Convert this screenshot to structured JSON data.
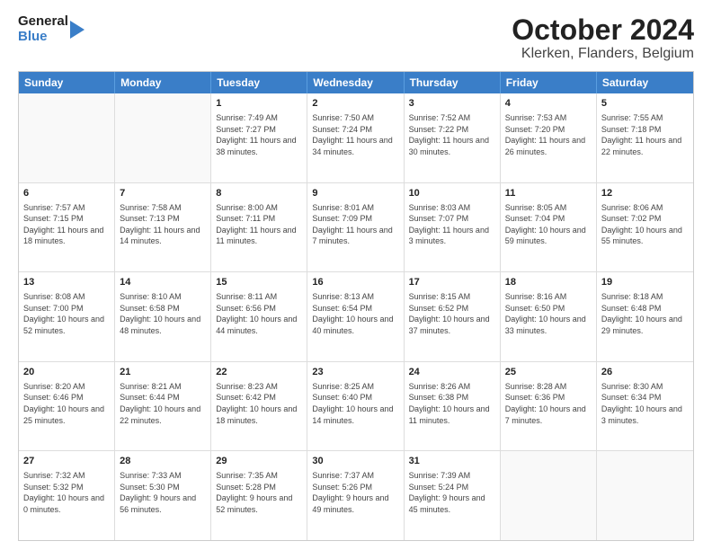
{
  "header": {
    "logo_line1": "General",
    "logo_line2": "Blue",
    "title": "October 2024",
    "subtitle": "Klerken, Flanders, Belgium"
  },
  "days_of_week": [
    "Sunday",
    "Monday",
    "Tuesday",
    "Wednesday",
    "Thursday",
    "Friday",
    "Saturday"
  ],
  "weeks": [
    [
      {
        "day": "",
        "info": ""
      },
      {
        "day": "",
        "info": ""
      },
      {
        "day": "1",
        "info": "Sunrise: 7:49 AM\nSunset: 7:27 PM\nDaylight: 11 hours and 38 minutes."
      },
      {
        "day": "2",
        "info": "Sunrise: 7:50 AM\nSunset: 7:24 PM\nDaylight: 11 hours and 34 minutes."
      },
      {
        "day": "3",
        "info": "Sunrise: 7:52 AM\nSunset: 7:22 PM\nDaylight: 11 hours and 30 minutes."
      },
      {
        "day": "4",
        "info": "Sunrise: 7:53 AM\nSunset: 7:20 PM\nDaylight: 11 hours and 26 minutes."
      },
      {
        "day": "5",
        "info": "Sunrise: 7:55 AM\nSunset: 7:18 PM\nDaylight: 11 hours and 22 minutes."
      }
    ],
    [
      {
        "day": "6",
        "info": "Sunrise: 7:57 AM\nSunset: 7:15 PM\nDaylight: 11 hours and 18 minutes."
      },
      {
        "day": "7",
        "info": "Sunrise: 7:58 AM\nSunset: 7:13 PM\nDaylight: 11 hours and 14 minutes."
      },
      {
        "day": "8",
        "info": "Sunrise: 8:00 AM\nSunset: 7:11 PM\nDaylight: 11 hours and 11 minutes."
      },
      {
        "day": "9",
        "info": "Sunrise: 8:01 AM\nSunset: 7:09 PM\nDaylight: 11 hours and 7 minutes."
      },
      {
        "day": "10",
        "info": "Sunrise: 8:03 AM\nSunset: 7:07 PM\nDaylight: 11 hours and 3 minutes."
      },
      {
        "day": "11",
        "info": "Sunrise: 8:05 AM\nSunset: 7:04 PM\nDaylight: 10 hours and 59 minutes."
      },
      {
        "day": "12",
        "info": "Sunrise: 8:06 AM\nSunset: 7:02 PM\nDaylight: 10 hours and 55 minutes."
      }
    ],
    [
      {
        "day": "13",
        "info": "Sunrise: 8:08 AM\nSunset: 7:00 PM\nDaylight: 10 hours and 52 minutes."
      },
      {
        "day": "14",
        "info": "Sunrise: 8:10 AM\nSunset: 6:58 PM\nDaylight: 10 hours and 48 minutes."
      },
      {
        "day": "15",
        "info": "Sunrise: 8:11 AM\nSunset: 6:56 PM\nDaylight: 10 hours and 44 minutes."
      },
      {
        "day": "16",
        "info": "Sunrise: 8:13 AM\nSunset: 6:54 PM\nDaylight: 10 hours and 40 minutes."
      },
      {
        "day": "17",
        "info": "Sunrise: 8:15 AM\nSunset: 6:52 PM\nDaylight: 10 hours and 37 minutes."
      },
      {
        "day": "18",
        "info": "Sunrise: 8:16 AM\nSunset: 6:50 PM\nDaylight: 10 hours and 33 minutes."
      },
      {
        "day": "19",
        "info": "Sunrise: 8:18 AM\nSunset: 6:48 PM\nDaylight: 10 hours and 29 minutes."
      }
    ],
    [
      {
        "day": "20",
        "info": "Sunrise: 8:20 AM\nSunset: 6:46 PM\nDaylight: 10 hours and 25 minutes."
      },
      {
        "day": "21",
        "info": "Sunrise: 8:21 AM\nSunset: 6:44 PM\nDaylight: 10 hours and 22 minutes."
      },
      {
        "day": "22",
        "info": "Sunrise: 8:23 AM\nSunset: 6:42 PM\nDaylight: 10 hours and 18 minutes."
      },
      {
        "day": "23",
        "info": "Sunrise: 8:25 AM\nSunset: 6:40 PM\nDaylight: 10 hours and 14 minutes."
      },
      {
        "day": "24",
        "info": "Sunrise: 8:26 AM\nSunset: 6:38 PM\nDaylight: 10 hours and 11 minutes."
      },
      {
        "day": "25",
        "info": "Sunrise: 8:28 AM\nSunset: 6:36 PM\nDaylight: 10 hours and 7 minutes."
      },
      {
        "day": "26",
        "info": "Sunrise: 8:30 AM\nSunset: 6:34 PM\nDaylight: 10 hours and 3 minutes."
      }
    ],
    [
      {
        "day": "27",
        "info": "Sunrise: 7:32 AM\nSunset: 5:32 PM\nDaylight: 10 hours and 0 minutes."
      },
      {
        "day": "28",
        "info": "Sunrise: 7:33 AM\nSunset: 5:30 PM\nDaylight: 9 hours and 56 minutes."
      },
      {
        "day": "29",
        "info": "Sunrise: 7:35 AM\nSunset: 5:28 PM\nDaylight: 9 hours and 52 minutes."
      },
      {
        "day": "30",
        "info": "Sunrise: 7:37 AM\nSunset: 5:26 PM\nDaylight: 9 hours and 49 minutes."
      },
      {
        "day": "31",
        "info": "Sunrise: 7:39 AM\nSunset: 5:24 PM\nDaylight: 9 hours and 45 minutes."
      },
      {
        "day": "",
        "info": ""
      },
      {
        "day": "",
        "info": ""
      }
    ]
  ]
}
